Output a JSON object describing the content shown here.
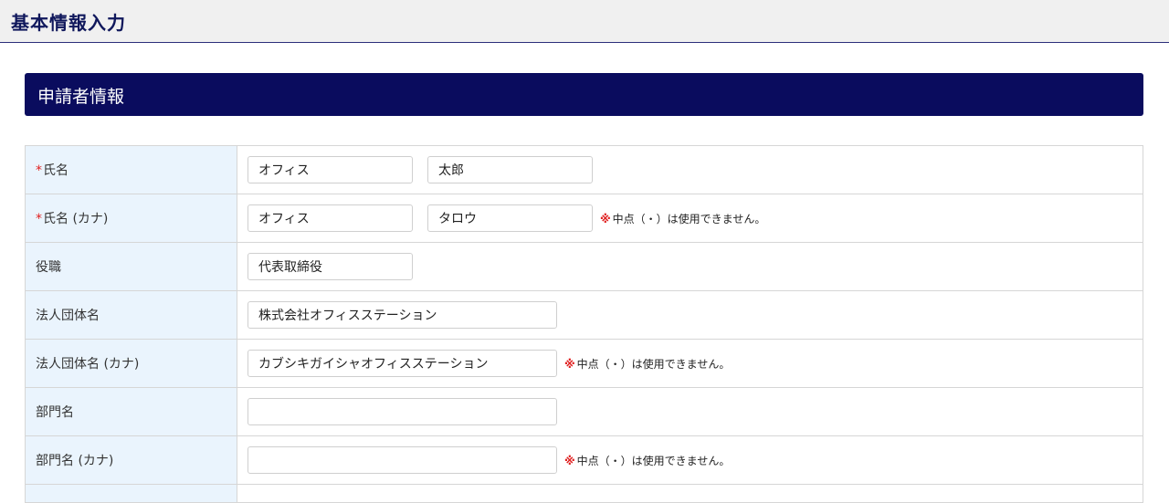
{
  "header": {
    "title": "基本情報入力"
  },
  "section": {
    "title": "申請者情報"
  },
  "required_mark": "*",
  "note": {
    "mark": "※",
    "text": "中点（・）は使用できません。"
  },
  "fields": {
    "name": {
      "label": "氏名",
      "last": "オフィス",
      "first": "太郎"
    },
    "name_kana": {
      "label": "氏名 (カナ)",
      "last": "オフィス",
      "first": "タロウ"
    },
    "position": {
      "label": "役職",
      "value": "代表取締役"
    },
    "org_name": {
      "label": "法人団体名",
      "value": "株式会社オフィスステーション"
    },
    "org_name_kana": {
      "label": "法人団体名 (カナ)",
      "value": "カブシキガイシャオフィスステーション"
    },
    "dept_name": {
      "label": "部門名",
      "value": ""
    },
    "dept_name_kana": {
      "label": "部門名 (カナ)",
      "value": ""
    }
  }
}
